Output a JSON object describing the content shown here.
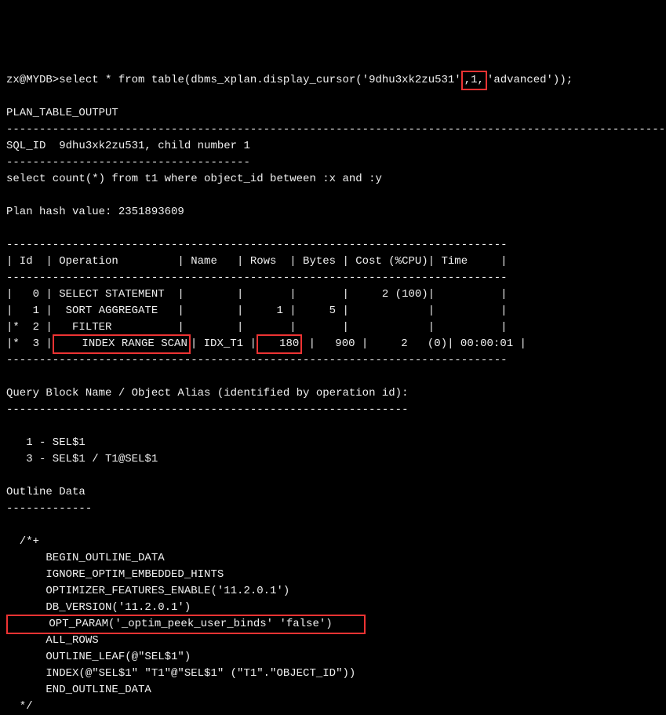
{
  "prompt": {
    "user": "zx@MYDB>",
    "command_before": "select * from table(dbms_xplan.display_cursor('9dhu3xk2zu531'",
    "highlighted_child": ",1,",
    "command_after": "'advanced'));"
  },
  "output": {
    "header_title": "PLAN_TABLE_OUTPUT",
    "divider_long": "--------------------------------------------------------------------------------------------------------------",
    "sql_id_line": "SQL_ID  9dhu3xk2zu531, child number 1",
    "divider_37": "-------------------------------------",
    "sql_text": "select count(*) from t1 where object_id between :x and :y",
    "plan_hash": "Plan hash value: 2351893609",
    "table": {
      "divider": "----------------------------------------------------------------------------",
      "header": "| Id  | Operation         | Name   | Rows  | Bytes | Cost (%CPU)| Time     |",
      "row0": "|   0 | SELECT STATEMENT  |        |       |       |     2 (100)|          |",
      "row1": "|   1 |  SORT AGGREGATE   |        |     1 |     5 |            |          |",
      "row2": "|*  2 |   FILTER          |        |       |       |            |          |",
      "row3_prefix": "|*  3 |",
      "row3_op": "    INDEX RANGE SCAN",
      "row3_mid": "| IDX_T1 |",
      "row3_rows": "   180",
      "row3_suffix": " |   900 |     2   (0)| 00:00:01 |"
    },
    "qbn_header": "Query Block Name / Object Alias (identified by operation id):",
    "qbn_divider": "-------------------------------------------------------------",
    "qbn_line1": "   1 - SEL$1",
    "qbn_line3": "   3 - SEL$1 / T1@SEL$1",
    "outline_header": "Outline Data",
    "outline_divider": "-------------",
    "outline": {
      "open": "  /*+",
      "begin": "      BEGIN_OUTLINE_DATA",
      "ignore": "      IGNORE_OPTIM_EMBEDDED_HINTS",
      "opt_features": "      OPTIMIZER_FEATURES_ENABLE('11.2.0.1')",
      "db_version": "      DB_VERSION('11.2.0.1')",
      "opt_param": "      OPT_PARAM('_optim_peek_user_binds' 'false')",
      "all_rows": "      ALL_ROWS",
      "outline_leaf": "      OUTLINE_LEAF(@\"SEL$1\")",
      "index": "      INDEX(@\"SEL$1\" \"T1\"@\"SEL$1\" (\"T1\".\"OBJECT_ID\"))",
      "end": "      END_OUTLINE_DATA",
      "close": "  */"
    }
  }
}
